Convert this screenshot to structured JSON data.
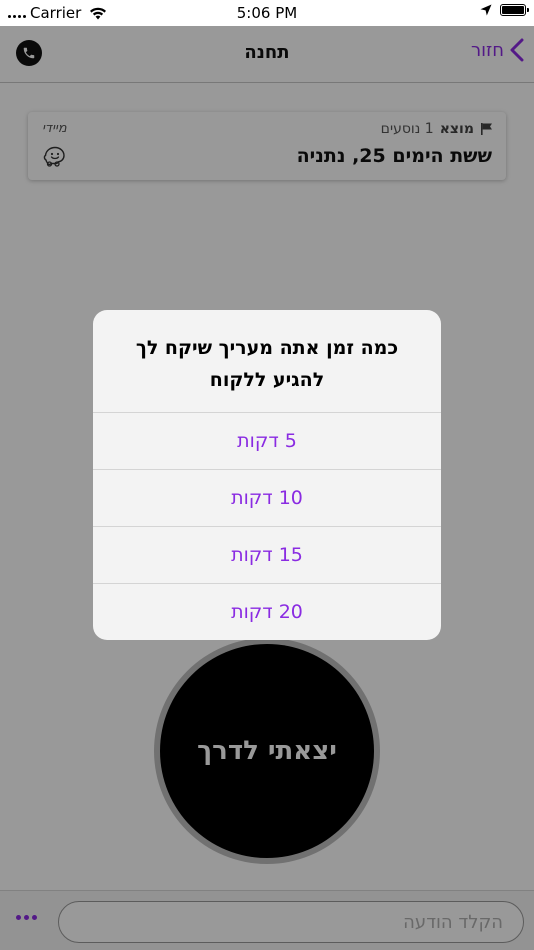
{
  "status_bar": {
    "carrier": "Carrier",
    "time": "5:06 PM",
    "battery_level": 1.0
  },
  "nav": {
    "title": "תחנה",
    "back_label": "חזור",
    "back_icon": "chevron-icon",
    "phone_icon": "phone-icon"
  },
  "station_card": {
    "origin_label": "מוצא",
    "passengers": "1 נוסעים",
    "address": "ששת הימים 25, נתניה",
    "time_label": "מיידי",
    "flag_icon": "flag-icon",
    "waze_icon": "waze-icon"
  },
  "go_button": {
    "label": "יצאתי לדרך"
  },
  "message_bar": {
    "placeholder": "הקלד הודעה",
    "more_icon": "more-icon"
  },
  "alert": {
    "title": "כמה זמן אתה מעריך שיקח לך להגיע ללקוח",
    "options": [
      {
        "label": "5 דקות"
      },
      {
        "label": "10 דקות"
      },
      {
        "label": "15 דקות"
      },
      {
        "label": "20 דקות"
      }
    ]
  },
  "colors": {
    "accent": "#8a2be2",
    "overlay": "rgba(0,0,0,0.40)",
    "go_button": "#000000"
  }
}
